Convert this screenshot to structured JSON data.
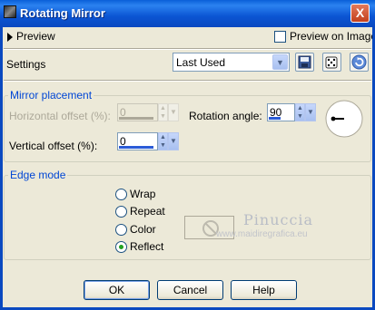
{
  "window": {
    "title": "Rotating Mirror",
    "close_label": "X"
  },
  "preview": {
    "toggle_label": "Preview",
    "preview_on_image_label": "Preview on Image",
    "preview_on_image_checked": false
  },
  "settings": {
    "label": "Settings",
    "selected": "Last Used",
    "dropdown_glyph": "▼"
  },
  "mirror_placement": {
    "title": "Mirror placement",
    "horizontal_offset_label": "Horizontal offset (%):",
    "horizontal_offset_value": "0",
    "vertical_offset_label": "Vertical offset (%):",
    "vertical_offset_value": "0",
    "rotation_angle_label": "Rotation angle:",
    "rotation_angle_value": "90",
    "rotation_dial_angle_deg": 90
  },
  "edge_mode": {
    "title": "Edge mode",
    "options": [
      "Wrap",
      "Repeat",
      "Color",
      "Reflect"
    ],
    "selected": "Reflect"
  },
  "watermark": {
    "name": "Pinuccia",
    "url": "www.maidiregrafica.eu"
  },
  "buttons": {
    "ok": "OK",
    "cancel": "Cancel",
    "help": "Help"
  },
  "glyphs": {
    "up": "▲",
    "down": "▼"
  },
  "colors": {
    "titlebar": "#0a5fd8",
    "group_title": "#0046d5",
    "radio_dot": "#21a121",
    "spin_bar": "#2a5bd7"
  }
}
